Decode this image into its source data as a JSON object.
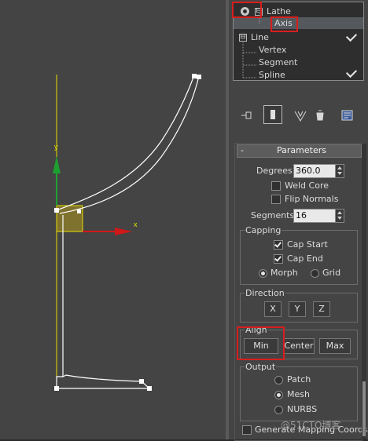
{
  "modifier_stack": {
    "items": [
      {
        "label": "Lathe",
        "expand": "⊟"
      },
      {
        "label": "Axis"
      },
      {
        "label": "Line",
        "expand": "⊟"
      },
      {
        "label": "Vertex"
      },
      {
        "label": "Segment"
      },
      {
        "label": "Spline"
      }
    ]
  },
  "viewport": {
    "axis_y_label": "y",
    "axis_x_label": "x",
    "colors": {
      "background": "#444444",
      "spline": "#ffffff",
      "axis_line": "#e8e000",
      "y_arrow": "#1ea030",
      "x_arrow": "#d01818"
    }
  },
  "parameters": {
    "header_label": "Parameters",
    "collapse_glyph": "-",
    "degrees_label": "Degrees:",
    "degrees_value": "360.0",
    "weld_core_label": "Weld Core",
    "weld_core_checked": false,
    "flip_normals_label": "Flip Normals",
    "flip_normals_checked": false,
    "segments_label": "Segments:",
    "segments_value": "16",
    "capping": {
      "title": "Capping",
      "cap_start_label": "Cap Start",
      "cap_start_checked": true,
      "cap_end_label": "Cap End",
      "cap_end_checked": true,
      "morph_label": "Morph",
      "grid_label": "Grid",
      "selected": "Morph"
    },
    "direction": {
      "title": "Direction",
      "buttons": [
        "X",
        "Y",
        "Z"
      ]
    },
    "align": {
      "title": "Align",
      "buttons": [
        "Min",
        "Center",
        "Max"
      ]
    },
    "output": {
      "title": "Output",
      "options": [
        "Patch",
        "Mesh",
        "NURBS"
      ],
      "selected": "Mesh"
    },
    "generate_mapping_label": "Generate Mapping Coords."
  },
  "watermark": "@51CTO博客",
  "colors": {
    "highlight_red": "#d81e1e",
    "panel": "#444444",
    "selected_row": "#55595e"
  }
}
